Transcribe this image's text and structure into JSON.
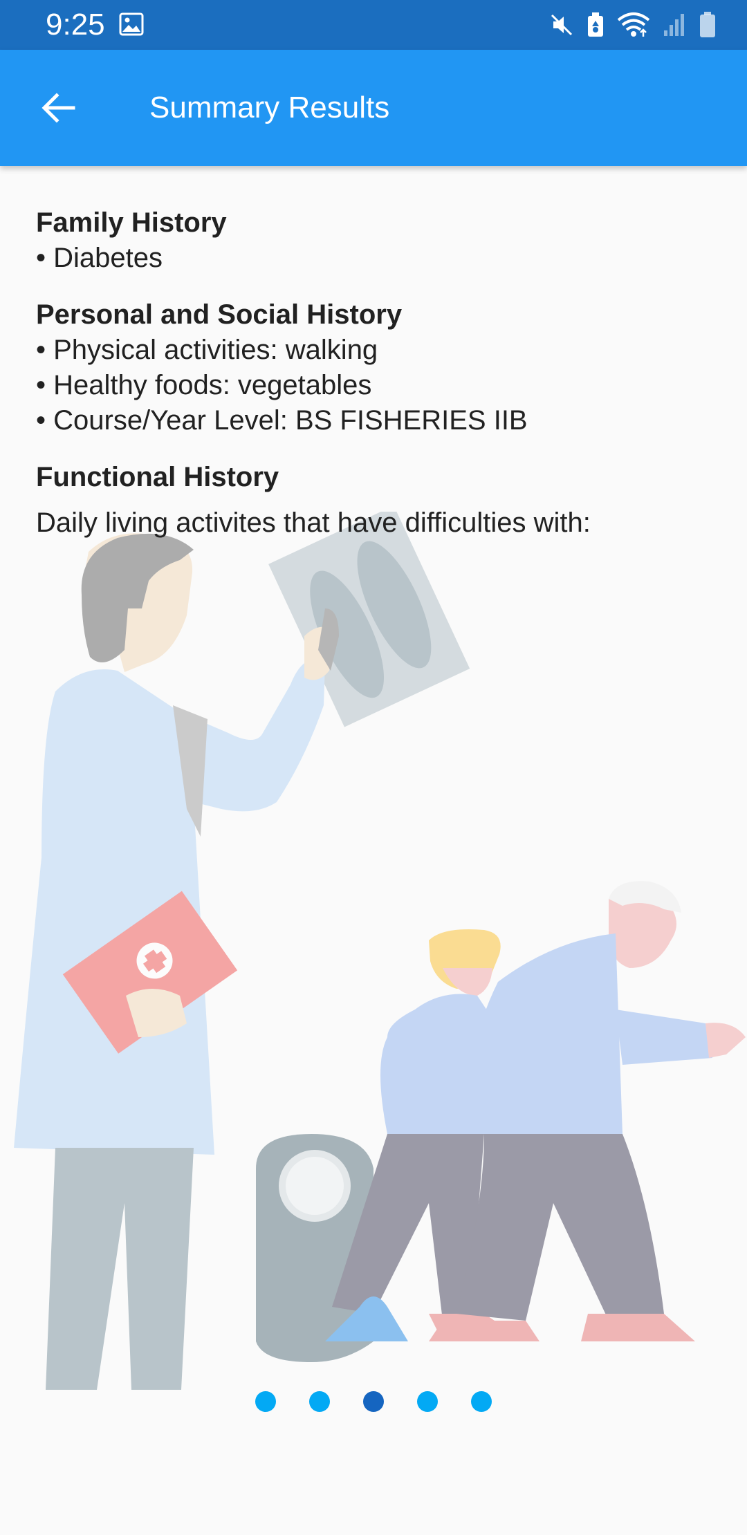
{
  "status_bar": {
    "time": "9:25",
    "icons": [
      "image-icon",
      "mute-icon",
      "battery-saver-icon",
      "wifi-icon",
      "signal-icon",
      "battery-icon"
    ]
  },
  "app_bar": {
    "title": "Summary Results",
    "back_icon": "arrow-left-icon"
  },
  "sections": {
    "family": {
      "title": "Family History",
      "items": [
        "• Diabetes"
      ]
    },
    "personal": {
      "title": "Personal and Social History",
      "items": [
        "• Physical activities: walking",
        "• Healthy foods: vegetables",
        "• Course/Year Level: BS FISHERIES IIB"
      ]
    },
    "functional": {
      "title": "Functional History",
      "description": "Daily living activites that have difficulties with:"
    }
  },
  "page_indicator": {
    "total": 5,
    "active_index": 2
  },
  "colors": {
    "status_bar": "#1b6ebf",
    "app_bar": "#2196f3",
    "dot": "#03a9f4",
    "dot_active": "#1565c0"
  }
}
